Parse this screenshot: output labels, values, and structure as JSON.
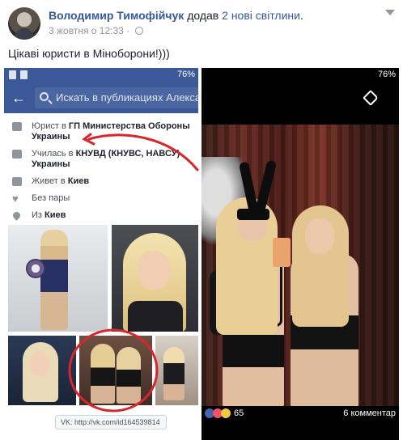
{
  "post": {
    "author": "Володимир Тимофійчук",
    "action": "додав",
    "action_link": "2 нові світлини",
    "timestamp": "3 жовтня о 12:33",
    "separator": "·",
    "text": "Цікаві юристи в Міноборони!)))"
  },
  "left_screenshot": {
    "battery": "76%",
    "search_placeholder": "Искать в публикациях Александ",
    "about": [
      {
        "prefix": "Юрист в ",
        "bold": "ГП Министерства Обороны Украины",
        "icon": "briefcase-icon"
      },
      {
        "prefix": "Училась в ",
        "bold": "КНУВД (КНУВС, НАВСУ) Украины",
        "icon": "graduation-cap-icon"
      },
      {
        "prefix": "Живет в ",
        "bold": "Киев",
        "icon": "home-icon"
      },
      {
        "prefix": "Без пары",
        "bold": "",
        "icon": "heart-icon"
      },
      {
        "prefix": "Из ",
        "bold": "Киев",
        "icon": "location-pin-icon"
      }
    ],
    "vk_badge": "VK: http://vk.com/id164539814"
  },
  "right_screenshot": {
    "battery": "76%",
    "reaction_count": "65",
    "comments": "6 комментар"
  },
  "colors": {
    "facebook_blue": "#3b5998",
    "link": "#365899",
    "annotation_red": "#d9262a"
  }
}
